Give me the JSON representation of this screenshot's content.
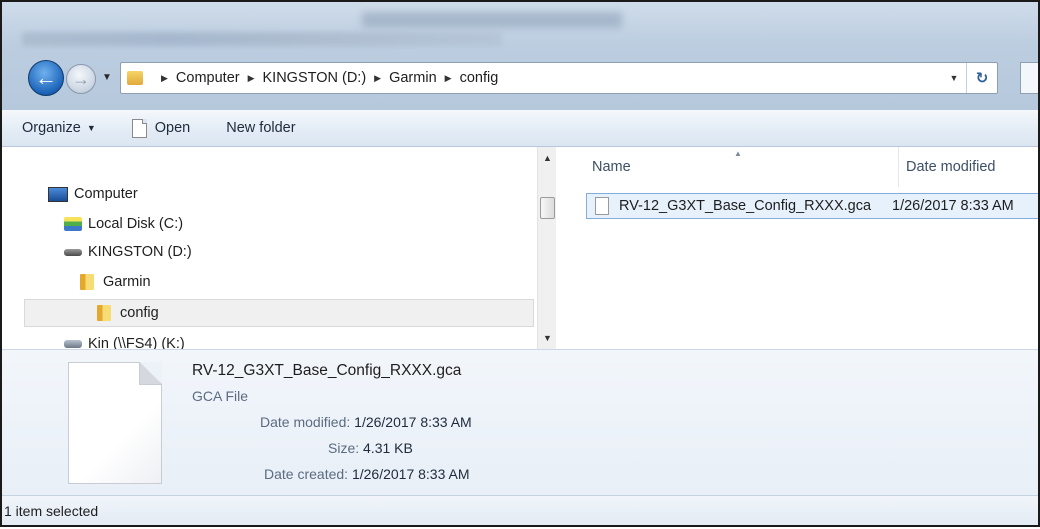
{
  "address": {
    "crumbs": [
      "Computer",
      "KINGSTON (D:)",
      "Garmin",
      "config"
    ]
  },
  "toolbar": {
    "organize_label": "Organize",
    "open_label": "Open",
    "new_folder_label": "New folder"
  },
  "nav_tree": {
    "items": [
      {
        "label": "Computer",
        "icon": "computer-icon"
      },
      {
        "label": "Local Disk (C:)",
        "icon": "local-disk-icon"
      },
      {
        "label": "KINGSTON (D:)",
        "icon": "usb-drive-icon"
      },
      {
        "label": "Garmin",
        "icon": "folder-icon"
      },
      {
        "label": "config",
        "icon": "folder-icon",
        "selected": true
      },
      {
        "label": "Kin (\\\\FS4) (K:)",
        "icon": "network-drive-icon"
      }
    ]
  },
  "file_list": {
    "columns": [
      "Name",
      "Date modified"
    ],
    "rows": [
      {
        "name": "RV-12_G3XT_Base_Config_RXXX.gca",
        "date_modified": "1/26/2017 8:33 AM"
      }
    ]
  },
  "details": {
    "file_name": "RV-12_G3XT_Base_Config_RXXX.gca",
    "file_type": "GCA File",
    "date_modified_label": "Date modified:",
    "date_modified": "1/26/2017 8:33 AM",
    "size_label": "Size:",
    "size": "4.31 KB",
    "date_created_label": "Date created:",
    "date_created": "1/26/2017 8:33 AM"
  },
  "status_bar": {
    "text": "1 item selected"
  }
}
